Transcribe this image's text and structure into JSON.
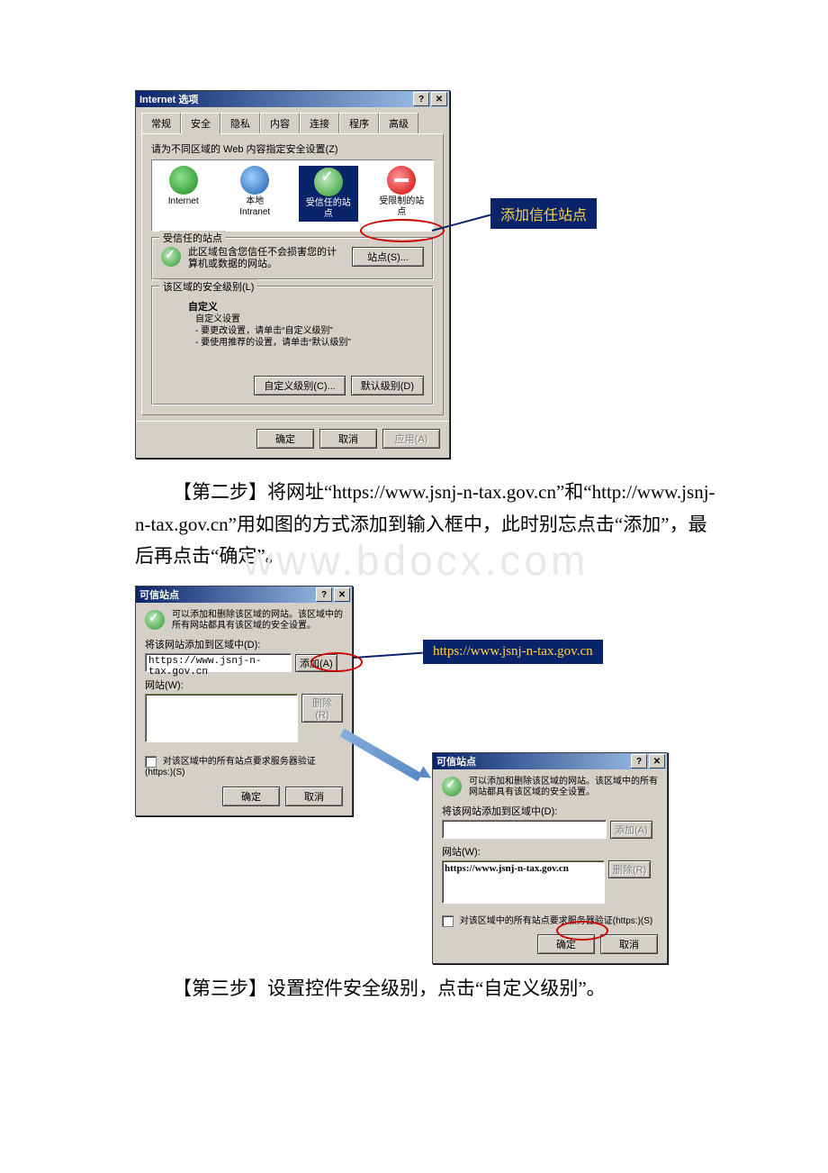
{
  "watermark": "www.bdocx.com",
  "internet_options": {
    "title": "Internet 选项",
    "tabs": [
      "常规",
      "安全",
      "隐私",
      "内容",
      "连接",
      "程序",
      "高级"
    ],
    "instruction": "请为不同区域的 Web 内容指定安全设置(Z)",
    "zones": {
      "internet": "Internet",
      "intranet_l1": "本地",
      "intranet_l2": "Intranet",
      "trusted_l1": "受信任的站",
      "trusted_l2": "点",
      "restricted_l1": "受限制的站",
      "restricted_l2": "点"
    },
    "trusted_group": {
      "legend": "受信任的站点",
      "desc": "此区域包含您信任不会损害您的计算机或数据的网站。",
      "sites_btn": "站点(S)..."
    },
    "level_group": {
      "legend": "该区域的安全级别(L)",
      "custom": "自定义",
      "custom_sub": "自定义设置",
      "line1": "- 要更改设置，请单击“自定义级别”",
      "line2": "- 要使用推荐的设置，请单击“默认级别”",
      "custom_btn": "自定义级别(C)...",
      "default_btn": "默认级别(D)"
    },
    "ok": "确定",
    "cancel": "取消",
    "apply": "应用(A)"
  },
  "callouts": {
    "add_trusted": "添加信任站点",
    "url_text": "https://www.jsnj-n-tax.gov.cn"
  },
  "paragraphs": {
    "step2": "【第二步】将网址“https://www.jsnj-n-tax.gov.cn”和“http://www.jsnj-n-tax.gov.cn”用如图的方式添加到输入框中，此时别忘点击“添加”，最后再点击“确定”。",
    "step3": "【第三步】设置控件安全级别，点击“自定义级别”。"
  },
  "trusted_dialog": {
    "title": "可信站点",
    "desc": "可以添加和删除该区域的网站。该区域中的所有网站都具有该区域的安全设置。",
    "add_label": "将该网站添加到区域中(D):",
    "input_value": "https://www.jsnj-n-tax.gov.cn",
    "add_btn": "添加(A)",
    "list_label": "网站(W):",
    "remove_btn": "删除(R)",
    "https_check": "对该区域中的所有站点要求服务器验证(https:)(S)",
    "ok": "确定",
    "cancel": "取消",
    "list_value": "https://www.jsnj-n-tax.gov.cn"
  }
}
